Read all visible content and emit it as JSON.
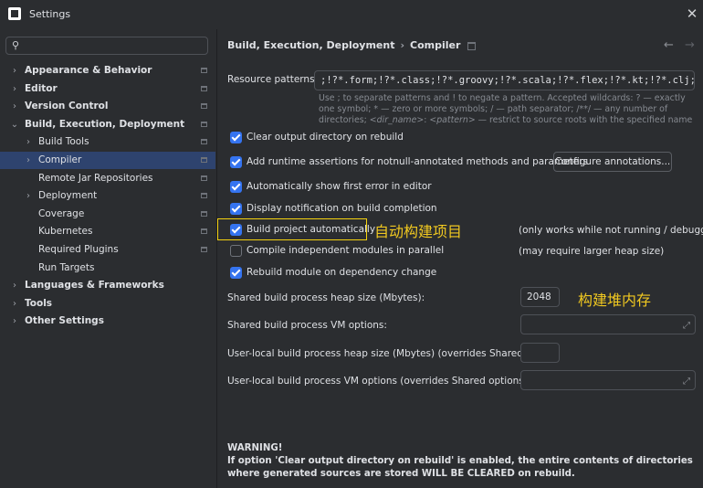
{
  "window": {
    "title": "Settings",
    "logo_letter": "IJ"
  },
  "search": {
    "placeholder": ""
  },
  "tree": [
    {
      "label": "Appearance & Behavior",
      "bold": true,
      "indent": 0,
      "chevron": "›",
      "pin": true
    },
    {
      "label": "Editor",
      "bold": true,
      "indent": 0,
      "chevron": "›",
      "pin": true
    },
    {
      "label": "Version Control",
      "bold": true,
      "indent": 0,
      "chevron": "›",
      "pin": true
    },
    {
      "label": "Build, Execution, Deployment",
      "bold": true,
      "indent": 0,
      "chevron": "⌄",
      "pin": true
    },
    {
      "label": "Build Tools",
      "bold": false,
      "indent": 1,
      "chevron": "›",
      "pin": true
    },
    {
      "label": "Compiler",
      "bold": false,
      "indent": 1,
      "chevron": "›",
      "pin": true,
      "selected": true
    },
    {
      "label": "Remote Jar Repositories",
      "bold": false,
      "indent": 1,
      "chevron": "",
      "pin": true
    },
    {
      "label": "Deployment",
      "bold": false,
      "indent": 1,
      "chevron": "›",
      "pin": true
    },
    {
      "label": "Coverage",
      "bold": false,
      "indent": 1,
      "chevron": "",
      "pin": true
    },
    {
      "label": "Kubernetes",
      "bold": false,
      "indent": 1,
      "chevron": "",
      "pin": true
    },
    {
      "label": "Required Plugins",
      "bold": false,
      "indent": 1,
      "chevron": "",
      "pin": true
    },
    {
      "label": "Run Targets",
      "bold": false,
      "indent": 1,
      "chevron": "",
      "pin": false
    },
    {
      "label": "Languages & Frameworks",
      "bold": true,
      "indent": 0,
      "chevron": "›",
      "pin": false
    },
    {
      "label": "Tools",
      "bold": true,
      "indent": 0,
      "chevron": "›",
      "pin": false
    },
    {
      "label": "Other Settings",
      "bold": true,
      "indent": 0,
      "chevron": "›",
      "pin": false
    }
  ],
  "breadcrumb": {
    "parent": "Build, Execution, Deployment",
    "current": "Compiler"
  },
  "resource": {
    "label": "Resource patterns:",
    "value": ";!?*.form;!?*.class;!?*.groovy;!?*.scala;!?*.flex;!?*.kt;!?*.clj;!?*.aj",
    "hint_1": "Use ; to separate patterns and ! to negate a pattern. Accepted wildcards: ? — exactly one symbol; * — zero or more symbols; / — path separator; /**/ — any number of directories; ",
    "hint_dir": "<dir_name>",
    "hint_2": ":",
    "hint_pattern": "<pattern>",
    "hint_3": " — restrict to source roots with the specified name"
  },
  "options": {
    "clear_output": {
      "label": "Clear output directory on rebuild",
      "checked": true
    },
    "runtime_assertions": {
      "label": "Add runtime assertions for notnull-annotated methods and parameters",
      "checked": true
    },
    "configure_button": "Configure annotations...",
    "show_error": {
      "label": "Automatically show first error in editor",
      "checked": true
    },
    "notification": {
      "label": "Display notification on build completion",
      "checked": true
    },
    "build_auto": {
      "label": "Build project automatically",
      "checked": true,
      "note": "(only works while not running / debugging)"
    },
    "compile_parallel": {
      "label": "Compile independent modules in parallel",
      "checked": false,
      "note": "(may require larger heap size)"
    },
    "rebuild_module": {
      "label": "Rebuild module on dependency change",
      "checked": true
    }
  },
  "annotations": {
    "build_auto": "自动构建项目",
    "heap": "构建堆内存"
  },
  "fields": {
    "shared_heap": {
      "label": "Shared build process heap size (Mbytes):",
      "value": "2048"
    },
    "shared_vm": {
      "label": "Shared build process VM options:",
      "value": ""
    },
    "user_heap": {
      "label": "User-local build process heap size (Mbytes) (overrides Shared size):",
      "value": ""
    },
    "user_vm": {
      "label": "User-local build process VM options (overrides Shared options):",
      "value": ""
    }
  },
  "warning": {
    "title": "WARNING!",
    "text": "If option 'Clear output directory on rebuild' is enabled, the entire contents of directories where generated sources are stored WILL BE CLEARED on rebuild."
  },
  "colors": {
    "accent": "#3574f0",
    "selection": "#2e436e",
    "highlight": "#f5d20f",
    "annotation": "#f0c820"
  },
  "icons": {
    "search": "search-icon",
    "close": "close-icon",
    "back": "arrow-left-icon",
    "forward": "arrow-right-icon",
    "pin": "pin-icon",
    "expand": "expand-icon"
  }
}
